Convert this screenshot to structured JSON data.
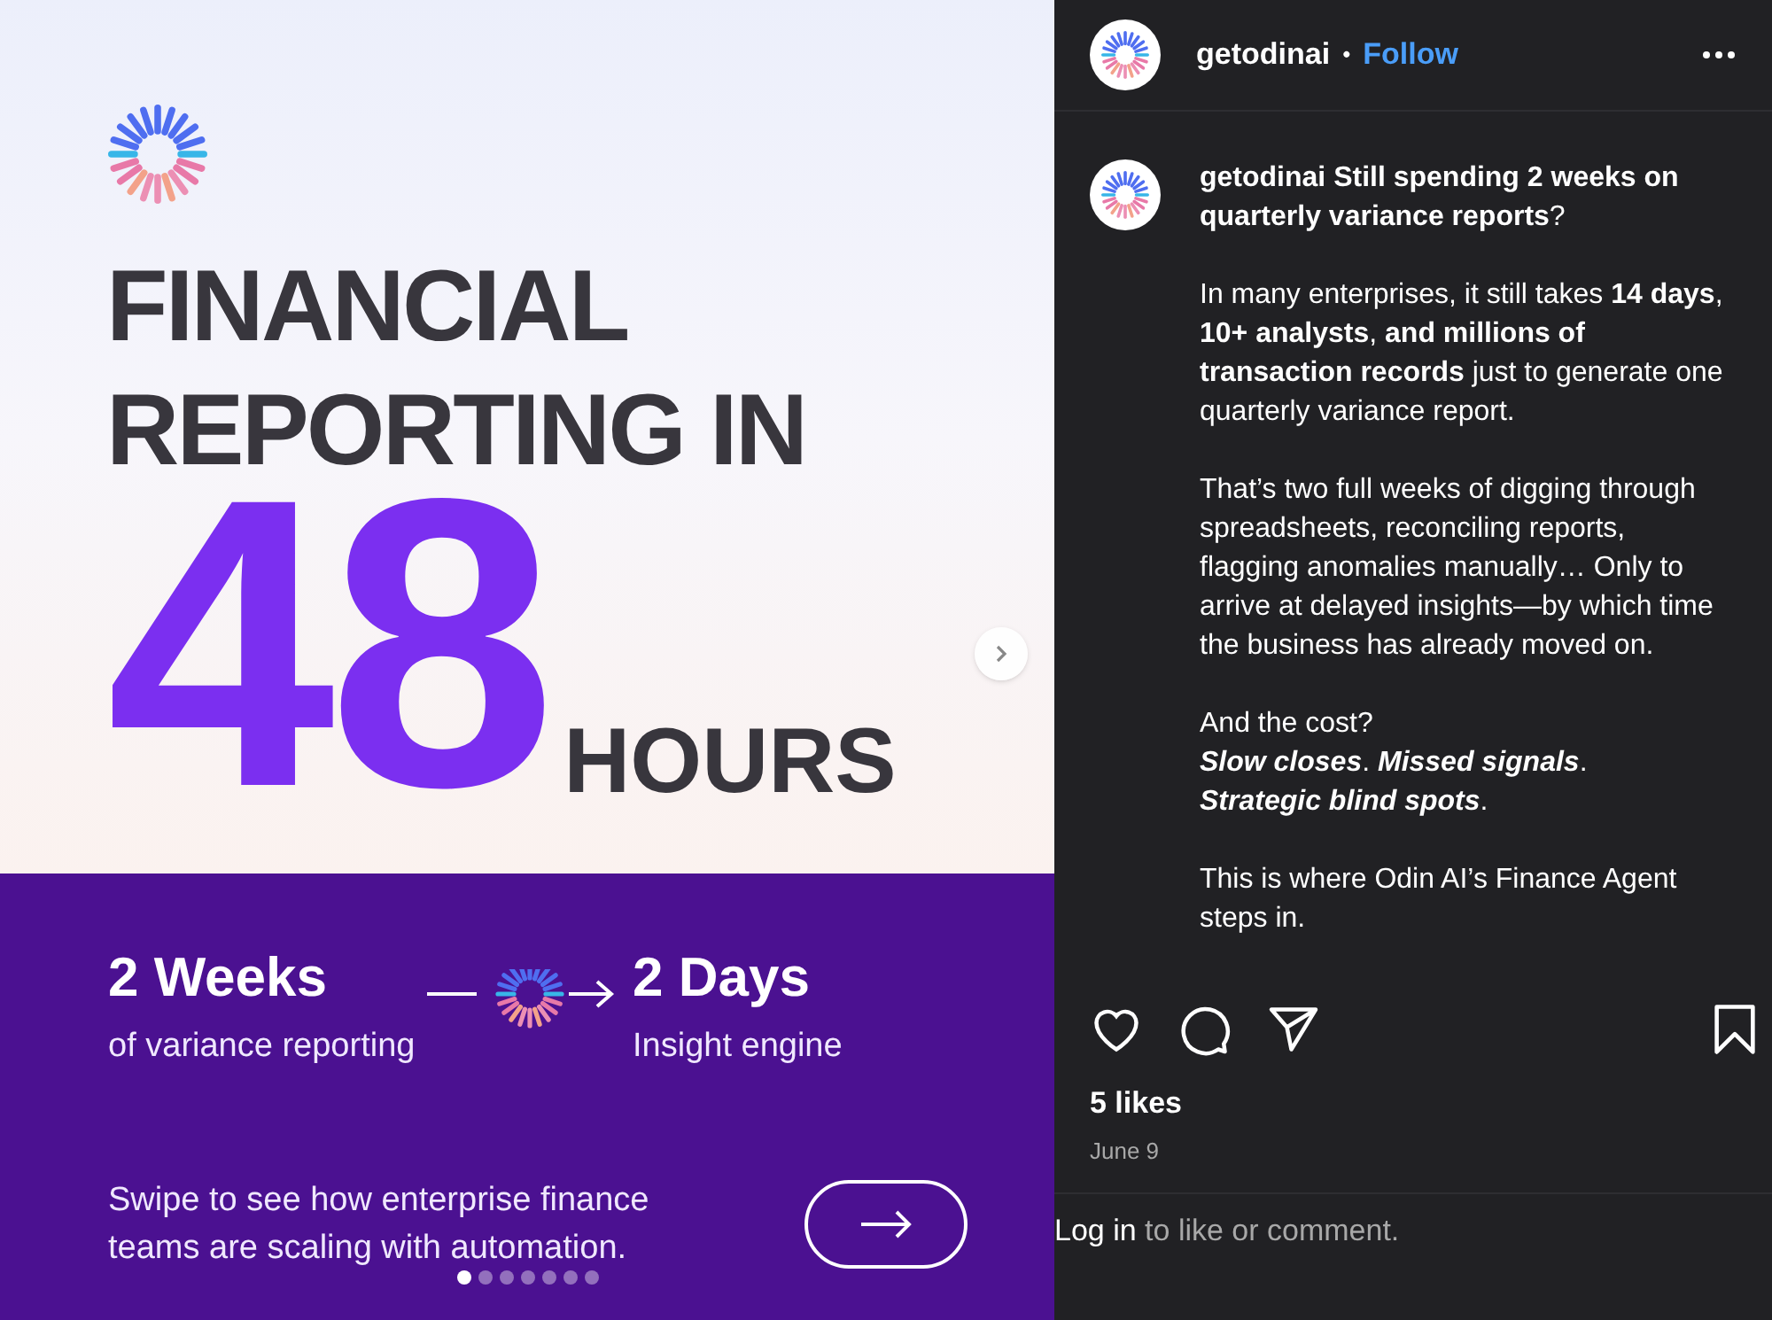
{
  "slide": {
    "headline": [
      "FINANCIAL",
      "REPORTING IN"
    ],
    "big_number": "48",
    "unit": "HOURS",
    "from": {
      "title": "2 Weeks",
      "subtitle": "of variance reporting"
    },
    "to": {
      "title": "2 Days",
      "subtitle": "Insight engine"
    },
    "footer": "Swipe to see how enterprise finance teams are scaling with automation.",
    "dots": [
      {
        "selected": true
      },
      {
        "selected": false
      },
      {
        "selected": false
      },
      {
        "selected": false
      },
      {
        "selected": false
      },
      {
        "selected": false
      },
      {
        "selected": false
      }
    ]
  },
  "post": {
    "username": "getodinai",
    "follow": "Follow",
    "separator": "•",
    "caption": [
      [
        "**getodinai** **Still spending 2 weeks on quarterly variance reports**?"
      ],
      [
        "In many enterprises, it still takes **14 days**, **10+ analysts**, **and millions of transaction records** just to generate one quarterly variance report."
      ],
      [
        "That’s two full weeks of digging through spreadsheets, reconciling reports, flagging anomalies manually… Only to arrive at delayed insights—by which time the business has already moved on."
      ],
      [
        "And the cost?",
        "*Slow closes*. *Missed signals*.",
        "*Strategic blind spots*."
      ],
      [
        "This is where Odin AI’s Finance Agent steps in."
      ]
    ],
    "likes": "5 likes",
    "date": "June 9",
    "login": {
      "link": "Log in",
      "text": " to like or comment."
    }
  }
}
